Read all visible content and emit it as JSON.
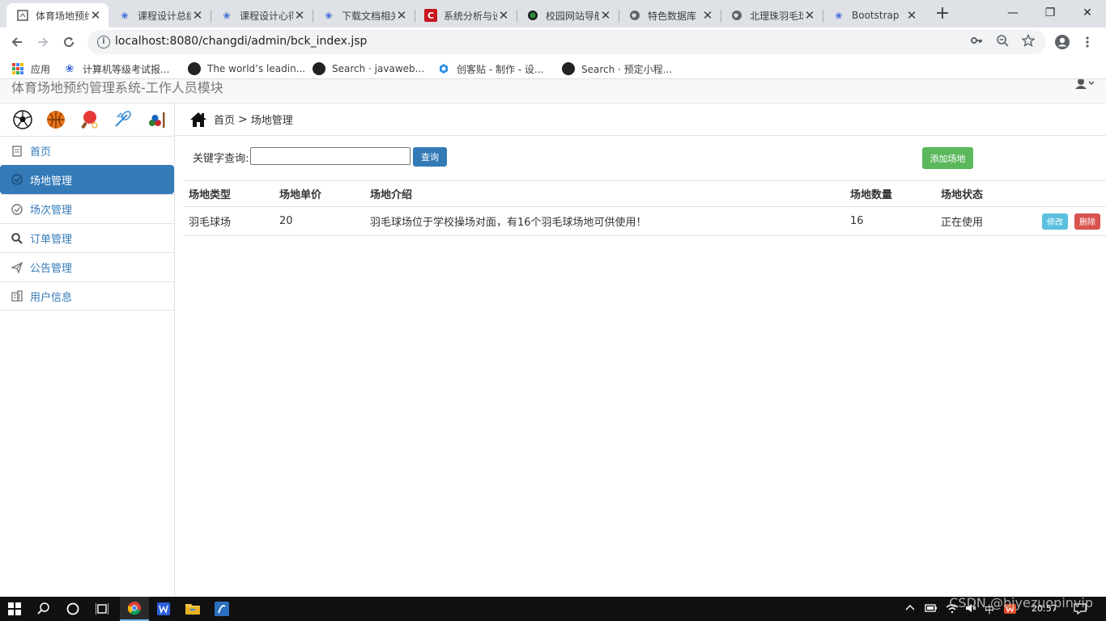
{
  "browser": {
    "tabs": [
      {
        "title": "体育场地预约",
        "favicon": "page-icon",
        "active": true
      },
      {
        "title": "课程设计总结",
        "favicon": "baidu-paw-icon"
      },
      {
        "title": "课程设计心得",
        "favicon": "baidu-paw-icon"
      },
      {
        "title": "下载文档相关",
        "favicon": "baidu-paw-icon"
      },
      {
        "title": "系统分析与设计",
        "favicon": "csdn-c-icon"
      },
      {
        "title": "校园网站导航",
        "favicon": "green-dot-icon"
      },
      {
        "title": "特色数据库",
        "favicon": "globe-icon"
      },
      {
        "title": "北理珠羽毛球",
        "favicon": "globe-icon"
      },
      {
        "title": "Bootstrap",
        "favicon": "baidu-paw-icon"
      }
    ],
    "new_tab": "+",
    "window_controls": {
      "minimize": "—",
      "restore": "❐",
      "close": "✕"
    },
    "url": "localhost:8080/changdi/admin/bck_index.jsp",
    "bookmarks": [
      {
        "label": "应用",
        "icon": "apps-grid-icon"
      },
      {
        "label": "计算机等级考试报...",
        "icon": "baidu-paw-icon"
      },
      {
        "label": "The world’s leadin...",
        "icon": "github-icon"
      },
      {
        "label": "Search · javaweb...",
        "icon": "github-icon"
      },
      {
        "label": "创客贴 - 制作 - 设...",
        "icon": "chuangketie-icon"
      },
      {
        "label": "Search · 预定小程...",
        "icon": "github-icon"
      }
    ]
  },
  "app": {
    "header_title": "体育场地预约管理系统-工作人员模块",
    "sidebar": {
      "sport_icons": [
        "soccer-ball-icon",
        "basketball-icon",
        "ping-pong-icon",
        "badminton-icon",
        "billiards-icon"
      ],
      "items": [
        {
          "label": "首页",
          "icon": "home-doc-icon",
          "active": false
        },
        {
          "label": "场地管理",
          "icon": "check-circle-icon",
          "active": true
        },
        {
          "label": "场次管理",
          "icon": "check-circle-icon",
          "active": false
        },
        {
          "label": "订单管理",
          "icon": "search-icon",
          "active": false
        },
        {
          "label": "公告管理",
          "icon": "send-icon",
          "active": false
        },
        {
          "label": "用户信息",
          "icon": "building-icon",
          "active": false
        }
      ]
    },
    "breadcrumb": {
      "home": "首页",
      "separator": ">",
      "current": "场地管理"
    },
    "search": {
      "label": "关键字查询:",
      "value": "",
      "placeholder": "",
      "button": "查询"
    },
    "add_button": "添加场地",
    "table": {
      "headers": [
        "场地类型",
        "场地单价",
        "场地介绍",
        "场地数量",
        "场地状态"
      ],
      "rows": [
        {
          "type": "羽毛球场",
          "price": "20",
          "intro": "羽毛球场位于学校操场对面，有16个羽毛球场地可供使用！",
          "count": "16",
          "status": "正在使用"
        }
      ],
      "edit_label": "修改",
      "delete_label": "删除"
    }
  },
  "taskbar": {
    "clock": "20:57",
    "ime": "中",
    "watermark": "CSDN @biyezuopinvip"
  }
}
